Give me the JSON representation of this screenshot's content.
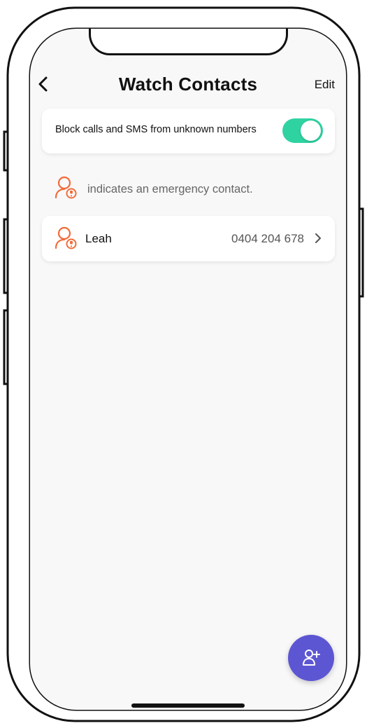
{
  "header": {
    "title": "Watch Contacts",
    "edit_label": "Edit",
    "back_icon": "chevron-left-icon"
  },
  "block_setting": {
    "label": "Block calls and SMS from unknown numbers",
    "enabled": true,
    "toggle_color": "#2fd3a2"
  },
  "legend": {
    "icon": "emergency-contact-icon",
    "text": "indicates an emergency contact."
  },
  "contacts": [
    {
      "name": "Leah",
      "phone": "0404 204 678",
      "emergency": true
    }
  ],
  "fab": {
    "icon": "add-contact-icon",
    "color": "#5d56d3"
  },
  "colors": {
    "accent_orange": "#f26b3a",
    "background": "#f8f8f8"
  }
}
